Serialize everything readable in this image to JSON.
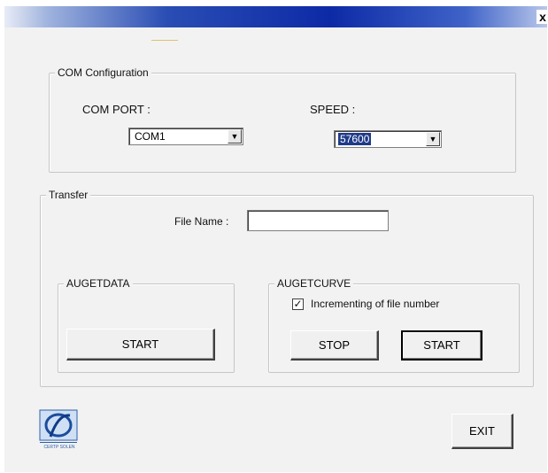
{
  "window": {
    "close_glyph": "x"
  },
  "com_config": {
    "title": "COM Configuration",
    "com_port_label": "COM PORT :",
    "com_port_value": "COM1",
    "speed_label": "SPEED :",
    "speed_value": "57600"
  },
  "transfer": {
    "title": "Transfer",
    "file_name_label": "File Name :",
    "file_name_value": "",
    "augetdata": {
      "title": "AUGETDATA",
      "start_label": "START"
    },
    "augetcurve": {
      "title": "AUGETCURVE",
      "checkbox_label": "Incrementing of file number",
      "checkbox_checked": true,
      "check_glyph": "✓",
      "stop_label": "STOP",
      "start_label": "START"
    }
  },
  "footer": {
    "exit_label": "EXIT",
    "logo_text": "CERTP SOLEN"
  },
  "colors": {
    "titlebar": "#0d2aa6",
    "dialog_bg": "#f2f2f2",
    "selection": "#1f3a88"
  },
  "icons": {
    "dropdown": "chevron-down-icon",
    "checkbox": "checkmark-icon",
    "logo": "certp-solen-logo"
  }
}
